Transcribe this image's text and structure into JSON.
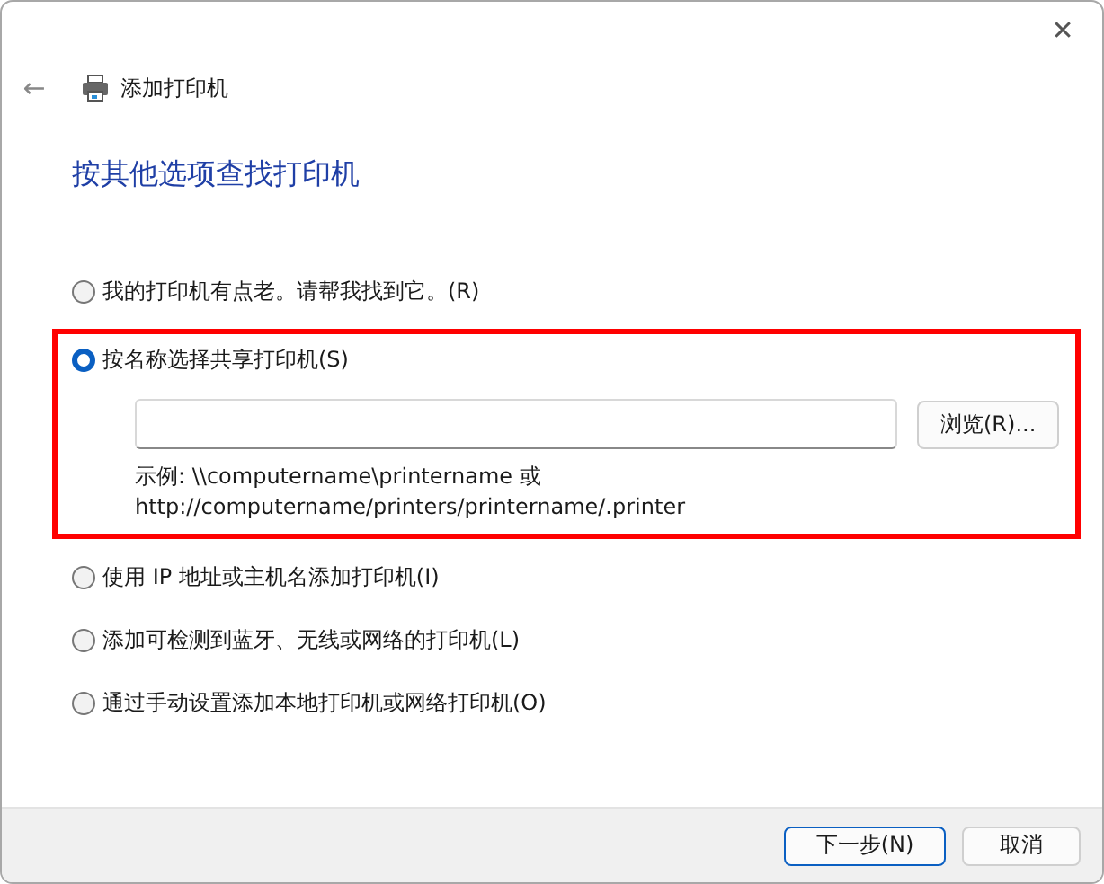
{
  "window": {
    "title": "添加打印机",
    "close": "✕",
    "back": "←"
  },
  "heading": "按其他选项查找打印机",
  "options": [
    {
      "label": "我的打印机有点老。请帮我找到它。(R)",
      "selected": false,
      "highlighted": false
    },
    {
      "label": "按名称选择共享打印机(S)",
      "selected": true,
      "highlighted": true,
      "browse_button": "浏览(R)...",
      "example_lines": [
        "示例: \\\\computername\\printername 或",
        "http://computername/printers/printername/.printer"
      ]
    },
    {
      "label": "使用 IP 地址或主机名添加打印机(I)",
      "selected": false,
      "highlighted": false
    },
    {
      "label": "添加可检测到蓝牙、无线或网络的打印机(L)",
      "selected": false,
      "highlighted": false
    },
    {
      "label": "通过手动设置添加本地打印机或网络打印机(O)",
      "selected": false,
      "highlighted": false
    }
  ],
  "buttons": [
    {
      "label": "下一步(N)",
      "default": true
    },
    {
      "label": "取消",
      "default": false
    }
  ]
}
